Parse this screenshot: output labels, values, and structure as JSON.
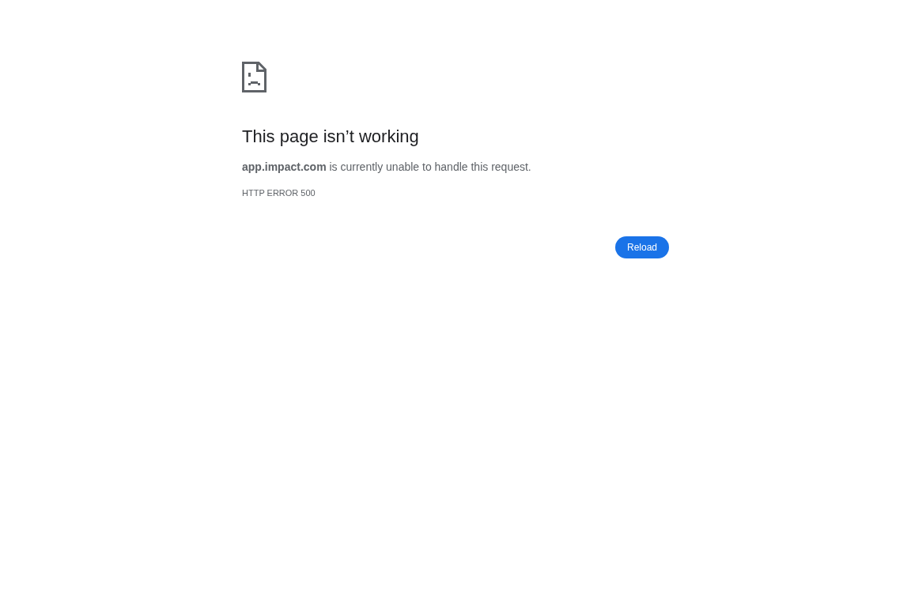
{
  "title": "This page isn’t working",
  "message": "**app.impact.com** is currently unable to handle this request.",
  "error_code": "HTTP ERROR 500",
  "buttons": [
    "Reload"
  ]
}
